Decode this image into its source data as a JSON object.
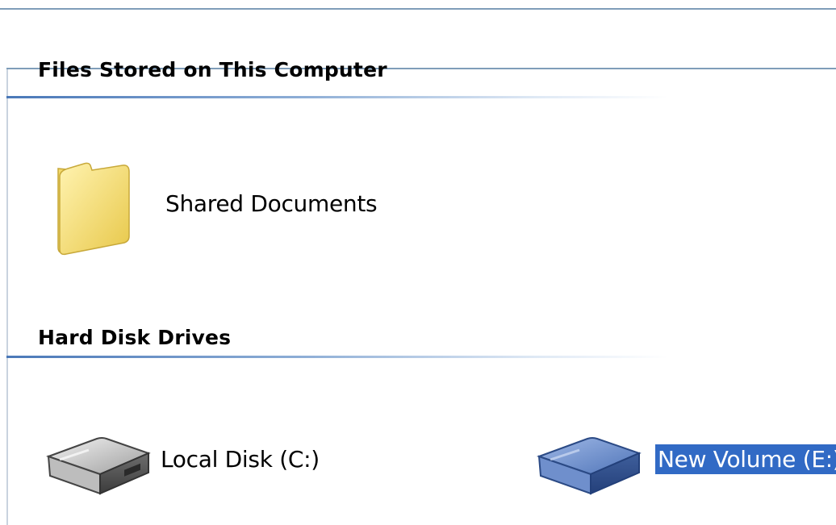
{
  "groups": [
    {
      "header": "Files Stored on This Computer",
      "items": [
        {
          "label": "Shared Documents",
          "icon": "folder-icon",
          "selected": false
        }
      ]
    },
    {
      "header": "Hard Disk Drives",
      "items": [
        {
          "label": "Local Disk (C:)",
          "icon": "hard-drive-icon",
          "selected": false
        },
        {
          "label": "New Volume (E:)",
          "icon": "hard-drive-selected-icon",
          "selected": true
        }
      ]
    }
  ],
  "colors": {
    "selection": "#316ac5",
    "group_rule": "#4a78b8",
    "folder": "#f6de7a",
    "drive_gray": "#9a9a9a",
    "drive_blue": "#5a7fc0"
  }
}
